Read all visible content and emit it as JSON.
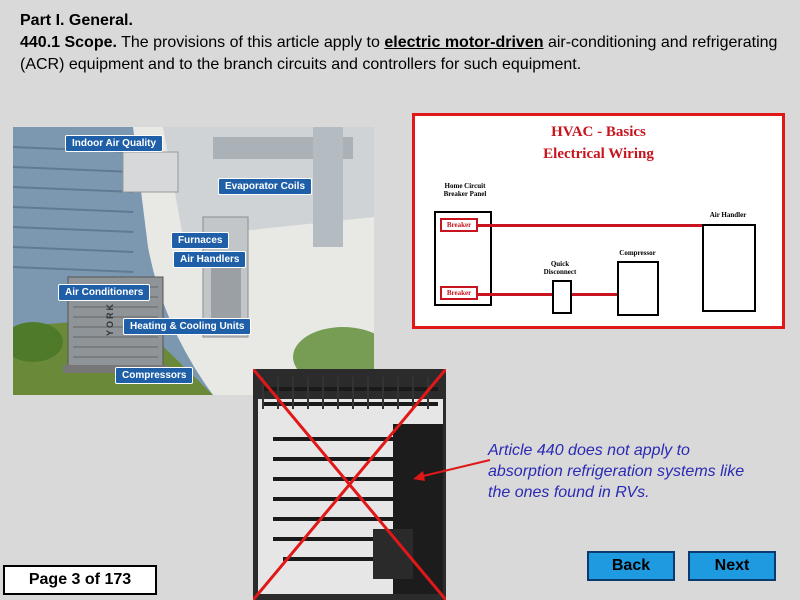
{
  "heading": {
    "part": "Part I. General.",
    "section_num": "440.1 Scope.",
    "text_before": " The provisions of this article apply to ",
    "highlight": "electric motor-driven",
    "text_after": " air-conditioning and refrigerating (ACR) equipment and to the branch circuits and controllers for such equipment."
  },
  "house_labels": {
    "indoor_air_quality": "Indoor Air Quality",
    "evaporator_coils": "Evaporator Coils",
    "furnaces": "Furnaces",
    "air_handlers": "Air Handlers",
    "air_conditioners": "Air Conditioners",
    "heating_cooling_units": "Heating & Cooling Units",
    "compressors": "Compressors",
    "brand": "YORK"
  },
  "wiring_diagram": {
    "title1": "HVAC - Basics",
    "title2": "Electrical Wiring",
    "panel_label": "Home Circuit Breaker Panel",
    "breaker1": "Breaker",
    "breaker2": "Breaker",
    "quick_disconnect": "Quick Disconnect",
    "compressor": "Compressor",
    "air_handler": "Air Handler"
  },
  "note": "Article 440 does not apply to absorption refrigeration systems like the ones found in RVs.",
  "nav": {
    "back": "Back",
    "next": "Next"
  },
  "page_counter": "Page 3 of 173",
  "colors": {
    "accent_red": "#e01818",
    "button_blue": "#1e9ae0",
    "note_blue": "#2a2ab4"
  }
}
